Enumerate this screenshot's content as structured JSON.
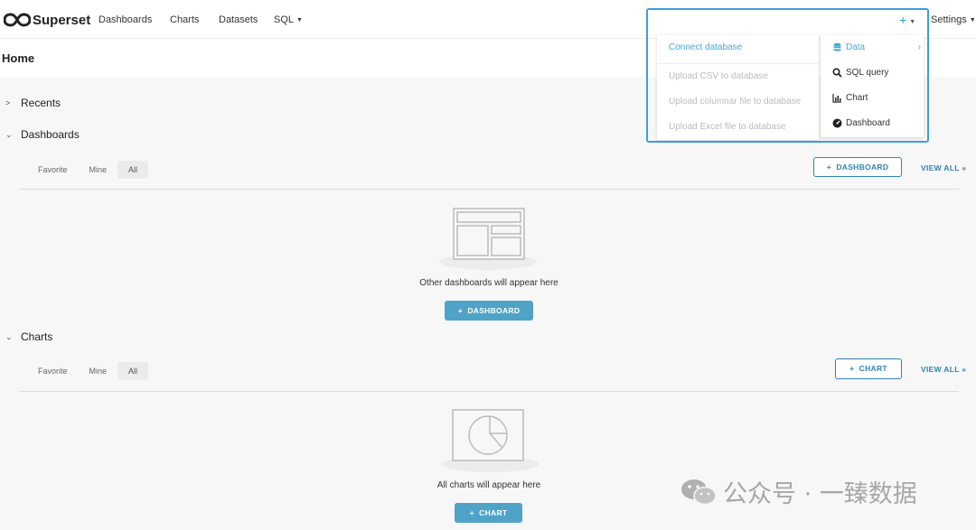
{
  "app": {
    "name": "Superset"
  },
  "nav": {
    "dashboards": "Dashboards",
    "charts": "Charts",
    "datasets": "Datasets",
    "sql": "SQL",
    "plus": "+",
    "settings": "Settings"
  },
  "header": {
    "title": "Home"
  },
  "recents": {
    "label": "Recents"
  },
  "dashboards": {
    "label": "Dashboards",
    "tabs": [
      "Favorite",
      "Mine",
      "All"
    ],
    "active_tab": "All",
    "add_button": "DASHBOARD",
    "view_all": "VIEW ALL »",
    "empty_text": "Other dashboards will appear here",
    "empty_button": "DASHBOARD"
  },
  "charts": {
    "label": "Charts",
    "tabs": [
      "Favorite",
      "Mine",
      "All"
    ],
    "active_tab": "All",
    "add_button": "CHART",
    "view_all": "VIEW ALL »",
    "empty_text": "All charts will appear here",
    "empty_button": "CHART"
  },
  "plus_menu": {
    "items": [
      "Data",
      "SQL query",
      "Chart",
      "Dashboard"
    ],
    "icons": [
      "database-icon",
      "search-icon",
      "chart-icon",
      "dashboard-icon"
    ],
    "active": "Data",
    "submenu": [
      "Connect database",
      "Upload CSV to database",
      "Upload columnar file to database",
      "Upload Excel file to database"
    ]
  },
  "watermark": {
    "text": "公众号 · 一臻数据"
  },
  "colors": {
    "accent": "#2f84b1",
    "button": "#4fa3c7",
    "highlight_border": "#3aa0dc",
    "link": "#4aa6d4"
  }
}
